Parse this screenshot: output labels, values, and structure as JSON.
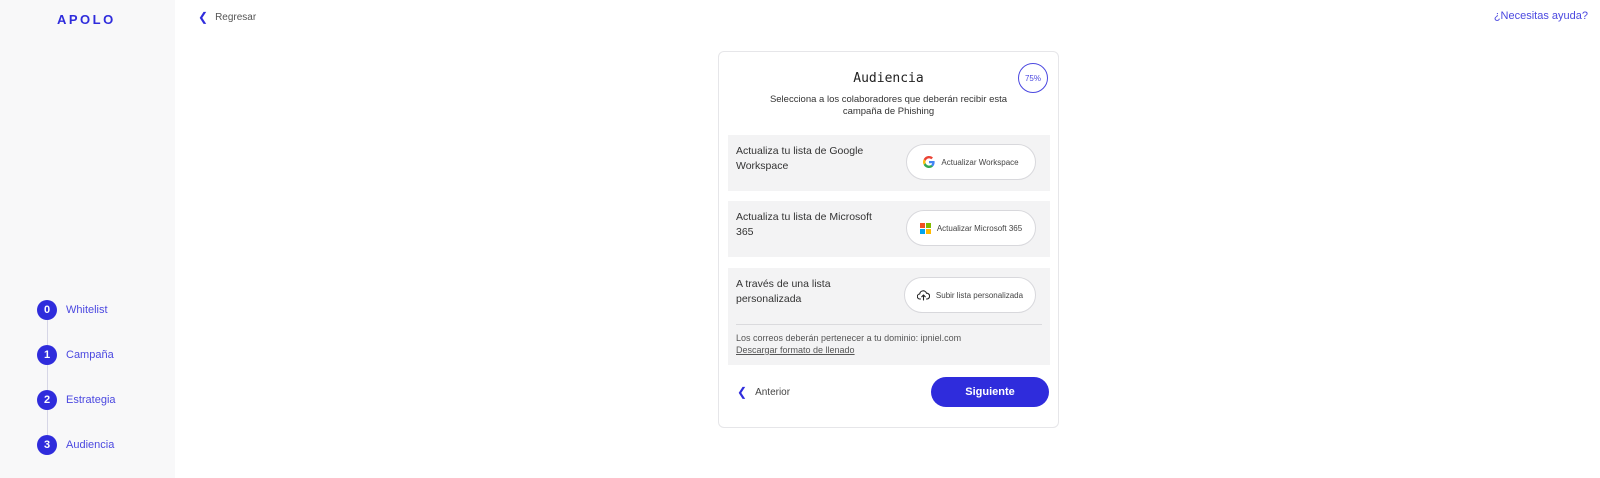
{
  "brand": {
    "logo": "APOLO",
    "accent": "#2f2cdc"
  },
  "header": {
    "back_label": "Regresar",
    "help_label": "¿Necesitas ayuda?"
  },
  "steps": [
    {
      "num": "0",
      "label": "Whitelist"
    },
    {
      "num": "1",
      "label": "Campaña"
    },
    {
      "num": "2",
      "label": "Estrategia"
    },
    {
      "num": "3",
      "label": "Audiencia"
    }
  ],
  "card": {
    "title": "Audiencia",
    "progress": "75%",
    "subtitle": "Selecciona a los colaboradores que deberán recibir esta campaña de Phishing",
    "options": [
      {
        "label": "Actualiza tu lista de Google Workspace",
        "button": "Actualizar Workspace",
        "icon": "google-icon"
      },
      {
        "label": "Actualiza tu lista de Microsoft 365",
        "button": "Actualizar Microsoft 365",
        "icon": "microsoft-icon"
      },
      {
        "label": "A través de una lista personalizada",
        "button": "Subir lista personalizada",
        "icon": "upload-cloud-icon"
      }
    ],
    "note": "Los correos deberán pertenecer a tu dominio: ipniel.com",
    "note_link": "Descargar formato de llenado",
    "prev_label": "Anterior",
    "next_label": "Siguiente"
  }
}
